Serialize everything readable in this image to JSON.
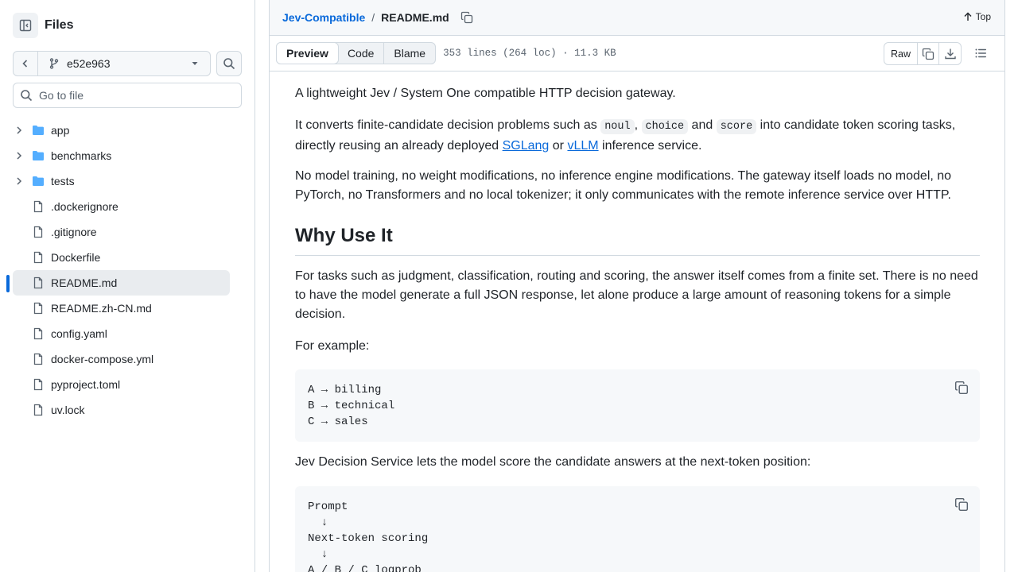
{
  "sidebar": {
    "title": "Files",
    "branch": "e52e963",
    "goto_placeholder": "Go to file",
    "items": [
      {
        "label": "app",
        "type": "folder"
      },
      {
        "label": "benchmarks",
        "type": "folder"
      },
      {
        "label": "tests",
        "type": "folder"
      },
      {
        "label": ".dockerignore",
        "type": "file"
      },
      {
        "label": ".gitignore",
        "type": "file"
      },
      {
        "label": "Dockerfile",
        "type": "file"
      },
      {
        "label": "README.md",
        "type": "file",
        "active": true
      },
      {
        "label": "README.zh-CN.md",
        "type": "file"
      },
      {
        "label": "config.yaml",
        "type": "file"
      },
      {
        "label": "docker-compose.yml",
        "type": "file"
      },
      {
        "label": "pyproject.toml",
        "type": "file"
      },
      {
        "label": "uv.lock",
        "type": "file"
      }
    ]
  },
  "header": {
    "repo": "Jev-Compatible",
    "sep": "/",
    "file": "README.md",
    "top_label": "Top"
  },
  "filebar": {
    "tabs": [
      "Preview",
      "Code",
      "Blame"
    ],
    "meta": "353 lines (264 loc) · 11.3 KB",
    "raw_label": "Raw"
  },
  "readme": {
    "p1": "A lightweight Jev / System One compatible HTTP decision gateway.",
    "p2_a": "It converts finite-candidate decision problems such as ",
    "code_noul": "noul",
    "p2_comma": ", ",
    "code_choice": "choice",
    "p2_and": " and ",
    "code_score": "score",
    "p2_b": " into candidate token scoring tasks, directly reusing an already deployed ",
    "link_sglang": "SGLang",
    "p2_or": " or ",
    "link_vllm": "vLLM",
    "p2_c": " inference service.",
    "p3": "No model training, no weight modifications, no inference engine modifications. The gateway itself loads no model, no PyTorch, no Transformers and no local tokenizer; it only communicates with the remote inference service over HTTP.",
    "h2": "Why Use It",
    "p4": "For tasks such as judgment, classification, routing and scoring, the answer itself comes from a finite set. There is no need to have the model generate a full JSON response, let alone produce a large amount of reasoning tokens for a simple decision.",
    "p5": "For example:",
    "code1": [
      "A → billing",
      "B → technical",
      "C → sales"
    ],
    "p6": "Jev Decision Service lets the model score the candidate answers at the next-token position:",
    "code2": [
      "Prompt",
      "  ↓",
      "Next-token scoring",
      "  ↓",
      "A / B / C logprob"
    ]
  }
}
